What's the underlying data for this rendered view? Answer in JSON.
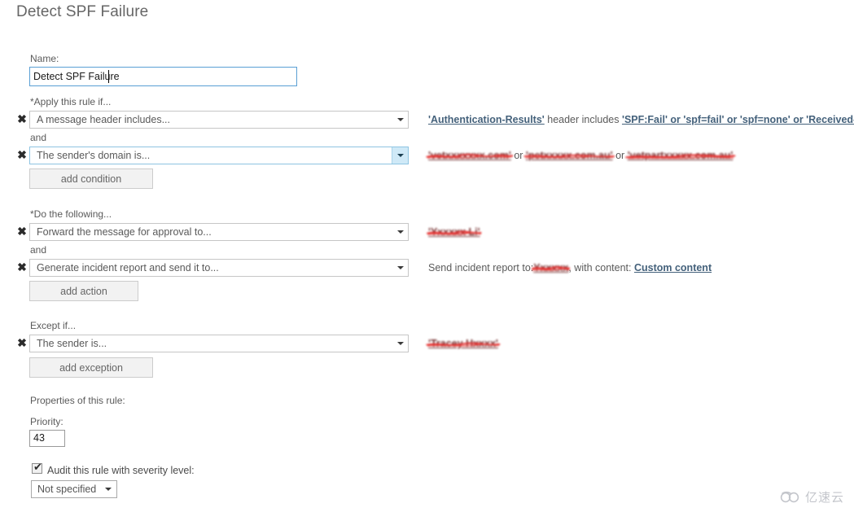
{
  "page": {
    "title": "Detect SPF Failure"
  },
  "name_field": {
    "label": "Name:",
    "value": "Detect SPF Failure",
    "placeholder": ""
  },
  "conditions": {
    "heading": "*Apply this rule if...",
    "connector": "and",
    "add_button": "add condition",
    "rows": [
      {
        "selected": "A message header includes...",
        "focused": false,
        "description": {
          "segments": [
            {
              "type": "link",
              "text": "'Authentication-Results'"
            },
            {
              "type": "text",
              "text": " header includes "
            },
            {
              "type": "link",
              "text": "'SPF:Fail' or 'spf=fail' or 'spf=none' or 'Received-SPF:Fail'"
            }
          ]
        }
      },
      {
        "selected": "The sender's domain is...",
        "focused": true,
        "description": {
          "segments": [
            {
              "type": "redacted",
              "text": "'vetxxxxxxx.com'"
            },
            {
              "type": "text",
              "text": " or "
            },
            {
              "type": "redacted",
              "text": "'petxxxxx.com.au'"
            },
            {
              "type": "text",
              "text": " or "
            },
            {
              "type": "redacted",
              "text": "'vetpartxxxxx.com.au'"
            }
          ]
        }
      }
    ]
  },
  "actions": {
    "heading": "*Do the following...",
    "connector": "and",
    "add_button": "add action",
    "rows": [
      {
        "selected": "Forward the message for approval to...",
        "focused": false,
        "description": {
          "segments": [
            {
              "type": "redacted",
              "text": "'Yxxxxx Li'"
            }
          ]
        }
      },
      {
        "selected": "Generate incident report and send it to...",
        "focused": false,
        "description": {
          "segments": [
            {
              "type": "text",
              "text": "Send incident report to:"
            },
            {
              "type": "redacted",
              "text": "Yxxxxx"
            },
            {
              "type": "text",
              "text": ", with content: "
            },
            {
              "type": "link",
              "text": "Custom content"
            }
          ]
        }
      }
    ]
  },
  "exceptions": {
    "heading": "Except if...",
    "add_button": "add exception",
    "rows": [
      {
        "selected": "The sender is...",
        "focused": false,
        "description": {
          "segments": [
            {
              "type": "redacted",
              "text": "'Tracey Hxxxx'"
            }
          ]
        }
      }
    ]
  },
  "properties": {
    "heading": "Properties of this rule:",
    "priority_label": "Priority:",
    "priority_value": "43",
    "audit_label": "Audit this rule with severity level:",
    "audit_checked": true,
    "severity_value": "Not specified"
  },
  "icons": {
    "remove": "✖",
    "checkmark": "✔"
  },
  "watermark": {
    "text": "亿速云"
  }
}
